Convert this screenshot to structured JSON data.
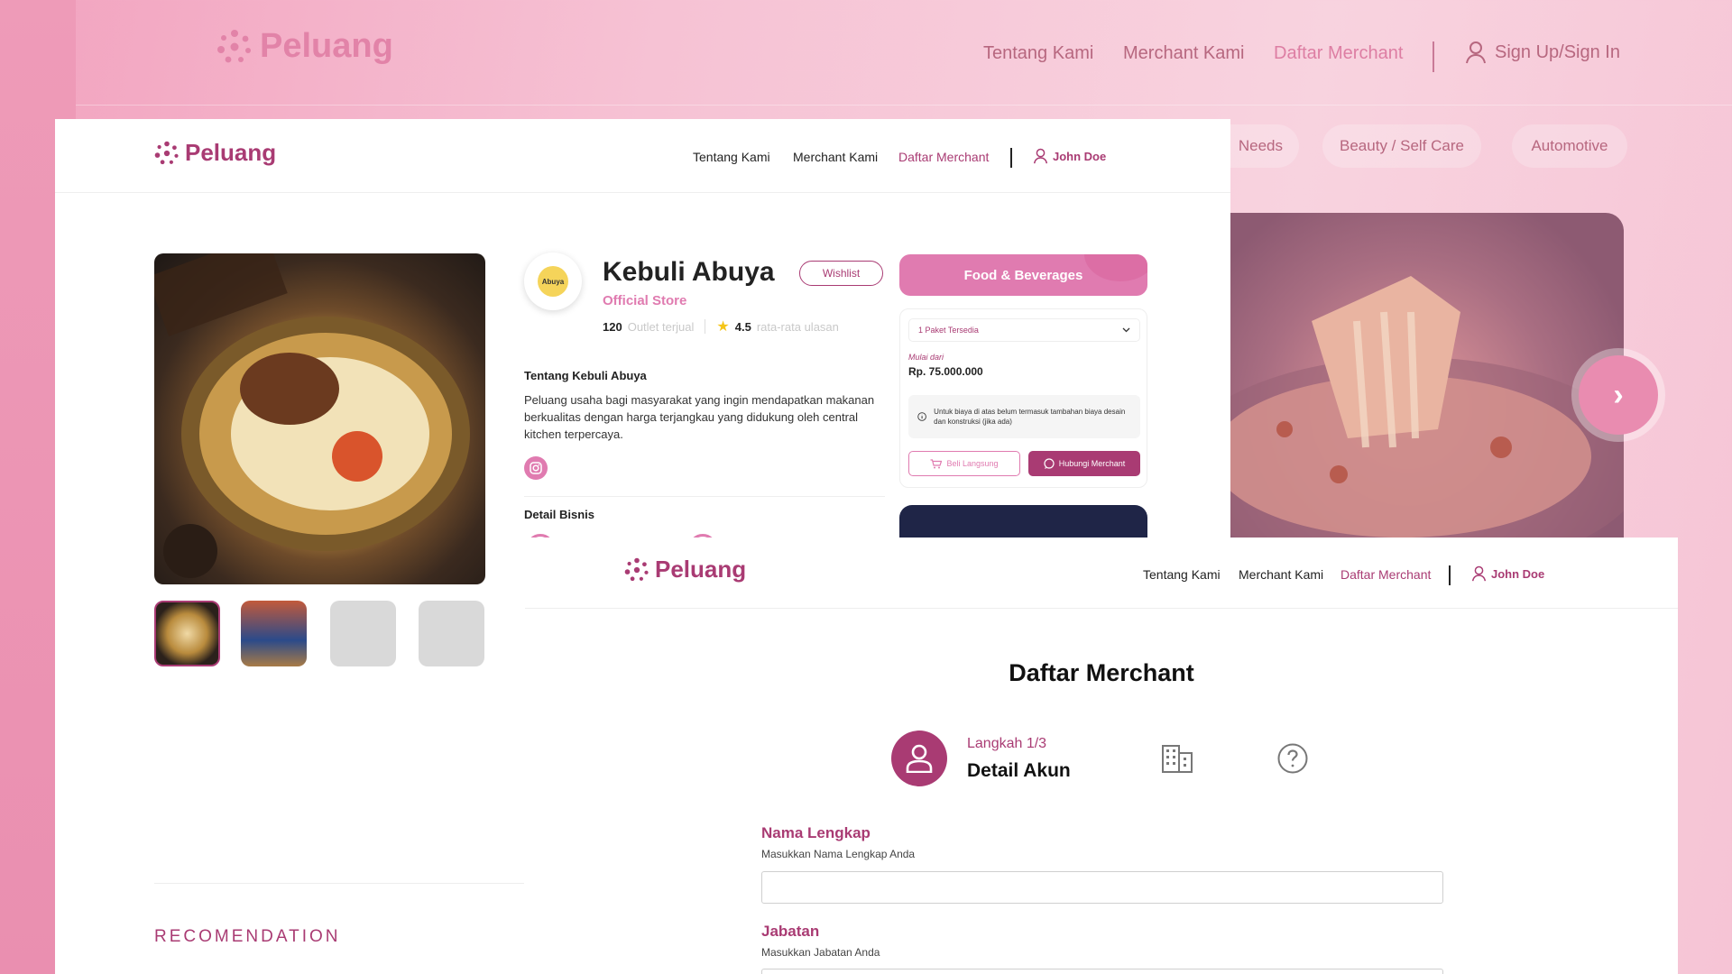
{
  "background": {
    "logo": "Peluang",
    "nav": [
      "Tentang Kami",
      "Merchant Kami",
      "Daftar Merchant"
    ],
    "sign_in": "Sign Up/Sign In",
    "categories": [
      "Needs",
      "Beauty / Self Care",
      "Automotive"
    ],
    "next_arrow": "›"
  },
  "detail_page": {
    "header": {
      "logo": "Peluang",
      "nav": [
        "Tentang Kami",
        "Merchant Kami",
        "Daftar Merchant"
      ],
      "user": "John Doe"
    },
    "store": {
      "avatar_text": "Abuya",
      "name": "Kebuli Abuya",
      "wishlist": "Wishlist",
      "badge": "Official Store",
      "outlets_count": "120",
      "outlets_label": "Outlet terjual",
      "rating": "4.5",
      "rating_label": "rata-rata ulasan"
    },
    "about": {
      "title": "Tentang Kebuli Abuya",
      "text": "Peluang usaha bagi masyarakat yang ingin mendapatkan makanan berkualitas dengan harga terjangkau yang didukung oleh central kitchen terpercaya."
    },
    "business_detail_title": "Detail Bisnis",
    "category": "Food & Beverages",
    "package": {
      "select": "1 Paket Tersedia",
      "price_label": "Mulai dari",
      "price": "Rp. 75.000.000",
      "note": "Untuk biaya di atas belum termasuk tambahan biaya desain dan konstruksi (jika ada)",
      "buy_button": "Beli Langsung",
      "contact_button": "Hubungi Merchant"
    },
    "recommendation": "RECOMENDATION"
  },
  "register_page": {
    "header": {
      "logo": "Peluang",
      "nav": [
        "Tentang Kami",
        "Merchant Kami",
        "Daftar Merchant"
      ],
      "user": "John Doe"
    },
    "title": "Daftar Merchant",
    "step": {
      "label": "Langkah 1/3",
      "name": "Detail Akun"
    },
    "fields": [
      {
        "label": "Nama Lengkap",
        "help": "Masukkan Nama Lengkap Anda",
        "value": ""
      },
      {
        "label": "Jabatan",
        "help": "Masukkan Jabatan  Anda",
        "value": ""
      }
    ]
  },
  "colors": {
    "brand": "#a93b73",
    "accent_pink": "#e07bb0",
    "dark_card": "#1f2547"
  }
}
